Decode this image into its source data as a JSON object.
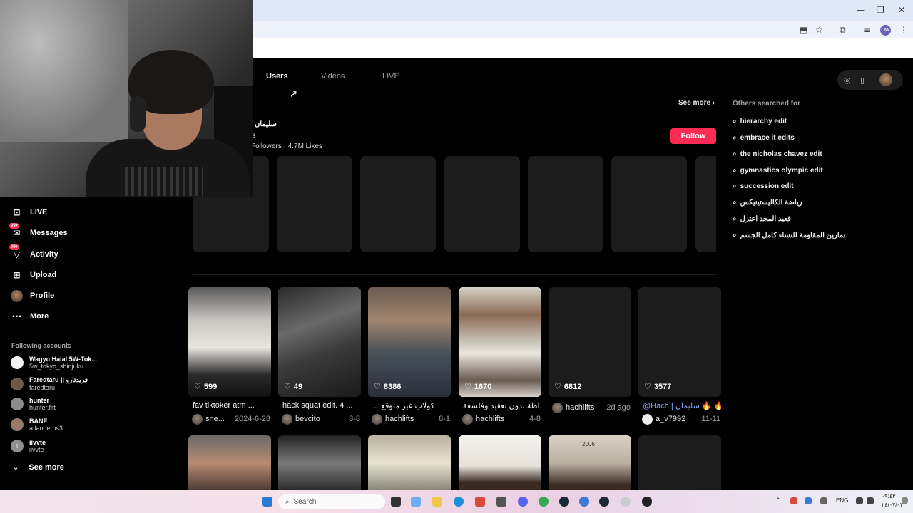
{
  "browser": {
    "win_minimize": "—",
    "win_restore": "❐",
    "win_close": "✕",
    "profile_initials": "OW"
  },
  "tabs": [
    {
      "label": "Users",
      "active": true
    },
    {
      "label": "Videos",
      "active": false
    },
    {
      "label": "LIVE",
      "active": false
    }
  ],
  "users_section": {
    "see_more": "See more",
    "name": "سليمان",
    "sub": "s",
    "stats": "Followers  ·  4.7M Likes",
    "follow": "Follow"
  },
  "others_searched": {
    "title": "Others searched for",
    "items": [
      "hierarchy edit",
      "embrace it edits",
      "the nicholas chavez edit",
      "gymnastics olympic edit",
      "succession edit",
      "رياضة الكاليستينيكس",
      "قعيد المجد اعتزل",
      "تمارين المقاومة للنساء كامل الجسم"
    ]
  },
  "sidebar": {
    "items": [
      {
        "label": "LIVE",
        "icon": "live-icon"
      },
      {
        "label": "Messages",
        "icon": "messages-icon",
        "badge": "99+"
      },
      {
        "label": "Activity",
        "icon": "activity-icon",
        "badge": "99+"
      },
      {
        "label": "Upload",
        "icon": "upload-icon"
      },
      {
        "label": "Profile",
        "icon": "profile-avatar"
      },
      {
        "label": "More",
        "icon": "more-icon"
      }
    ],
    "following_title": "Following accounts",
    "accounts": [
      {
        "name": "Wagyu Halal 5W-Tok...",
        "handle": "5w_tokyo_shinjuku"
      },
      {
        "name": "Faredtaru || فريدتارو",
        "handle": "faredtaru"
      },
      {
        "name": "hunter",
        "handle": "hunter.fitt"
      },
      {
        "name": "BANE",
        "handle": "a.landeros3"
      },
      {
        "name": "iivvte",
        "handle": "iivvte",
        "initial": "I"
      }
    ],
    "see_more": "See more"
  },
  "videos": [
    {
      "likes": "599",
      "caption": "fav tiktoker atm ...",
      "author": "sne...",
      "date": "2024-6-28"
    },
    {
      "likes": "49",
      "caption": "hack squat edit. 4 ...",
      "author": "bevcito",
      "date": "8-8"
    },
    {
      "likes": "8386",
      "caption": "... كولاب غير متوقع",
      "author": "hachlifts",
      "date": "8-1"
    },
    {
      "likes": "1670",
      "caption": "كل بساطة بدون تعقيد وفلسفة...",
      "author": "hachlifts",
      "date": "4-8"
    },
    {
      "likes": "6812",
      "caption": "",
      "author": "hachlifts",
      "date": "2d ago"
    },
    {
      "likes": "3577",
      "caption": "@Hach | سليمان 🔥 🔥",
      "author": "a_v7992",
      "date": "11-11"
    }
  ],
  "row2_texts": {
    "year": "2006"
  },
  "taskbar": {
    "search": "Search",
    "lang": "ENG",
    "time": "٠٩:٤٣",
    "date": "٢٤/٠٧/٠٣"
  }
}
